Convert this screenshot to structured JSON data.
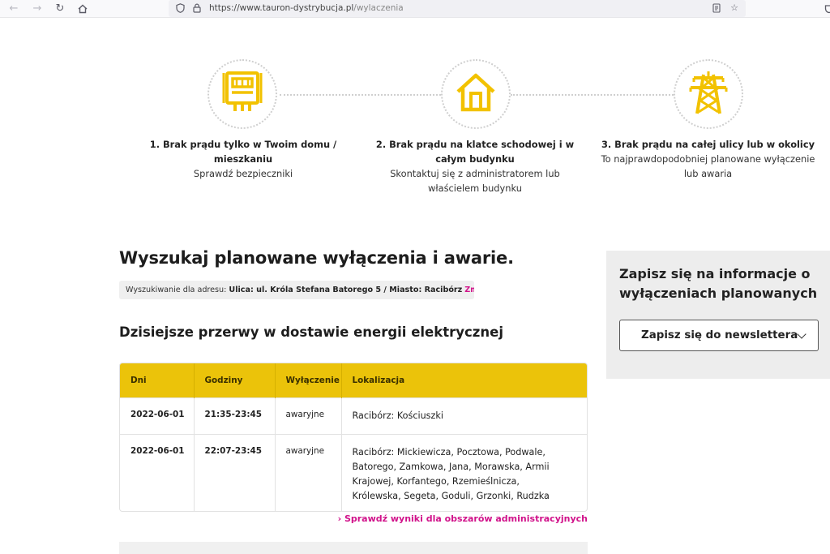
{
  "browser": {
    "url_host": "https://www.tauron-dystrybucja.pl",
    "url_path": "/wylaczenia"
  },
  "steps": [
    {
      "icon": "electric-meter-icon",
      "title": "1. Brak prądu tylko w Twoim domu / mieszkaniu",
      "desc": "Sprawdź bezpieczniki"
    },
    {
      "icon": "house-icon",
      "title": "2. Brak prądu na klatce schodowej i w całym budynku",
      "desc": "Skontaktuj się z administratorem lub właścielem budynku"
    },
    {
      "icon": "power-pylon-icon",
      "title": "3. Brak prądu na całej ulicy lub w okolicy",
      "desc": "To najprawdopodobniej planowane wyłączenie lub awaria"
    }
  ],
  "search": {
    "title": "Wyszukaj planowane wyłączenia i awarie.",
    "address_prefix": "Wyszukiwanie dla adresu:",
    "address_value": "Ulica: ul. Króla Stefana Batorego 5 / Miasto: Racibórz",
    "change_label": "Zmień"
  },
  "outages": {
    "title": "Dzisiejsze przerwy w dostawie energii elektrycznej",
    "columns": [
      "Dni",
      "Godziny",
      "Wyłączenie",
      "Lokalizacja"
    ],
    "rows": [
      {
        "date": "2022-06-01",
        "hours": "21:35-23:45",
        "type": "awaryjne",
        "location": "Racibórz: Kościuszki"
      },
      {
        "date": "2022-06-01",
        "hours": "22:07-23:45",
        "type": "awaryjne",
        "location": "Racibórz: Mickiewicza, Pocztowa, Podwale, Batorego, Zamkowa, Jana, Morawska, Armii Krajowej, Korfantego, Rzemieślnicza, Królewska, Segeta, Goduli, Grzonki, Rudzka"
      }
    ],
    "admin_link": "Sprawdź wyniki dla obszarów administracyjnych"
  },
  "newsletter": {
    "title": "Zapisz się na informacje o wyłączeniach planowanych",
    "button_label": "Zapisz się do newslettera"
  },
  "colors": {
    "accent_yellow": "#ebc30a",
    "link_magenta": "#d1128a"
  }
}
